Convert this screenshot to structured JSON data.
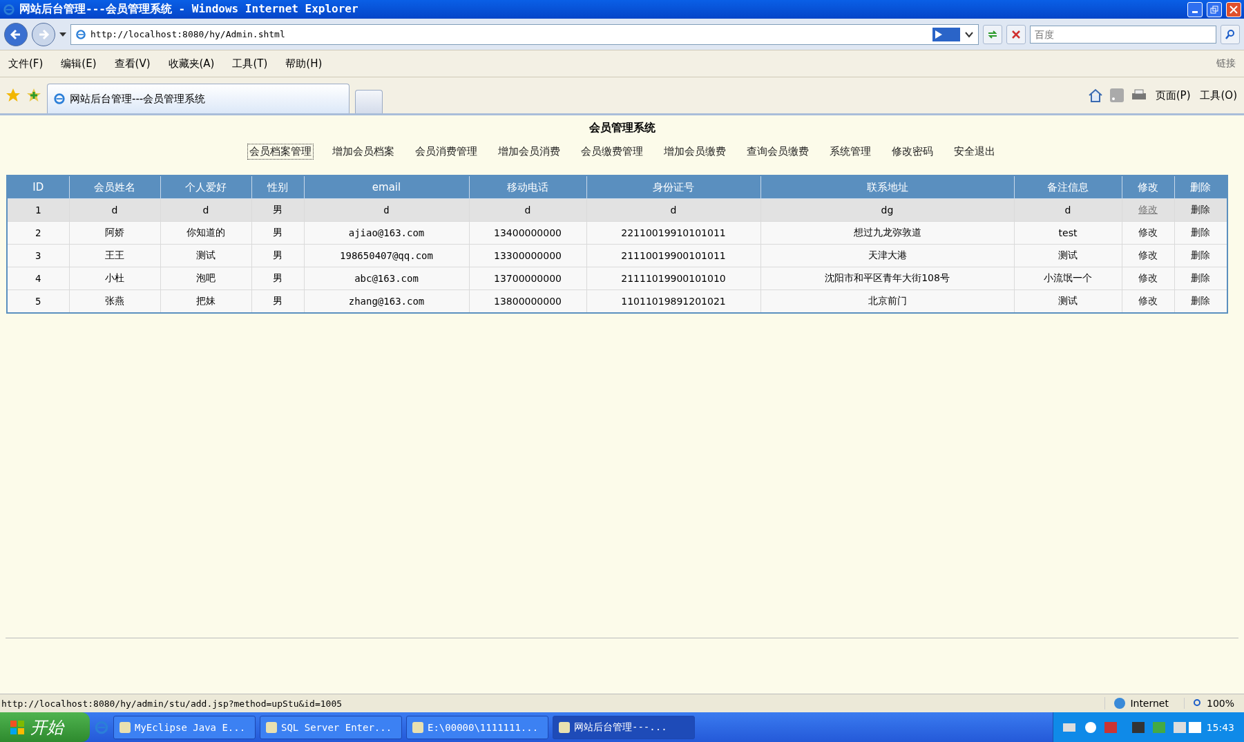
{
  "window": {
    "title": "网站后台管理---会员管理系统 - Windows Internet Explorer"
  },
  "address_bar": {
    "url": "http://localhost:8080/hy/Admin.shtml",
    "search_placeholder": "百度"
  },
  "menu": [
    "文件(F)",
    "编辑(E)",
    "查看(V)",
    "收藏夹(A)",
    "工具(T)",
    "帮助(H)"
  ],
  "links_label": "链接",
  "tabs": [
    {
      "label": "网站后台管理---会员管理系统",
      "selected": true
    }
  ],
  "command_bar": [
    "页面(P)",
    "工具(O)"
  ],
  "page": {
    "title": "会员管理系统",
    "nav_links": [
      {
        "label": "会员档案管理",
        "focused": true
      },
      {
        "label": "增加会员档案",
        "focused": false
      },
      {
        "label": "会员消费管理",
        "focused": false
      },
      {
        "label": "增加会员消费",
        "focused": false
      },
      {
        "label": "会员缴费管理",
        "focused": false
      },
      {
        "label": "增加会员缴费",
        "focused": false
      },
      {
        "label": "查询会员缴费",
        "focused": false
      },
      {
        "label": "系统管理",
        "focused": false
      },
      {
        "label": "修改密码",
        "focused": false
      },
      {
        "label": "安全退出",
        "focused": false
      }
    ]
  },
  "table": {
    "columns": [
      "ID",
      "会员姓名",
      "个人爱好",
      "性别",
      "email",
      "移动电话",
      "身份证号",
      "联系地址",
      "备注信息",
      "修改",
      "删除"
    ],
    "rows": [
      {
        "cells": [
          "1",
          "d",
          "d",
          "男",
          "d",
          "d",
          "d",
          "dg",
          "d"
        ],
        "edit": "修改",
        "delete": "删除",
        "highlighted": true
      },
      {
        "cells": [
          "2",
          "阿娇",
          "你知道的",
          "男",
          "ajiao@163.com",
          "13400000000",
          "22110019910101011",
          "想过九龙弥敦道",
          "test"
        ],
        "edit": "修改",
        "delete": "删除",
        "highlighted": false
      },
      {
        "cells": [
          "3",
          "王王",
          "测试",
          "男",
          "198650407@qq.com",
          "13300000000",
          "21110019900101011",
          "天津大港",
          "测试"
        ],
        "edit": "修改",
        "delete": "删除",
        "highlighted": false
      },
      {
        "cells": [
          "4",
          "小杜",
          "泡吧",
          "男",
          "abc@163.com",
          "13700000000",
          "21111019900101010",
          "沈阳市和平区青年大街108号",
          "小流氓一个"
        ],
        "edit": "修改",
        "delete": "删除",
        "highlighted": false
      },
      {
        "cells": [
          "5",
          "张燕",
          "把妹",
          "男",
          "zhang@163.com",
          "13800000000",
          "11011019891201021",
          "北京前门",
          "测试"
        ],
        "edit": "修改",
        "delete": "删除",
        "highlighted": false
      }
    ]
  },
  "status_bar": {
    "url": "http://localhost:8080/hy/admin/stu/add.jsp?method=upStu&id=1005",
    "zone": "Internet",
    "zoom": "100%"
  },
  "taskbar": {
    "start": "开始",
    "tasks": [
      {
        "label": "MyEclipse Java E...",
        "selected": false
      },
      {
        "label": "SQL Server Enter...",
        "selected": false
      },
      {
        "label": "E:\\00000\\1111111...",
        "selected": false
      },
      {
        "label": "网站后台管理---...",
        "selected": true
      }
    ],
    "clock": "15:43"
  }
}
